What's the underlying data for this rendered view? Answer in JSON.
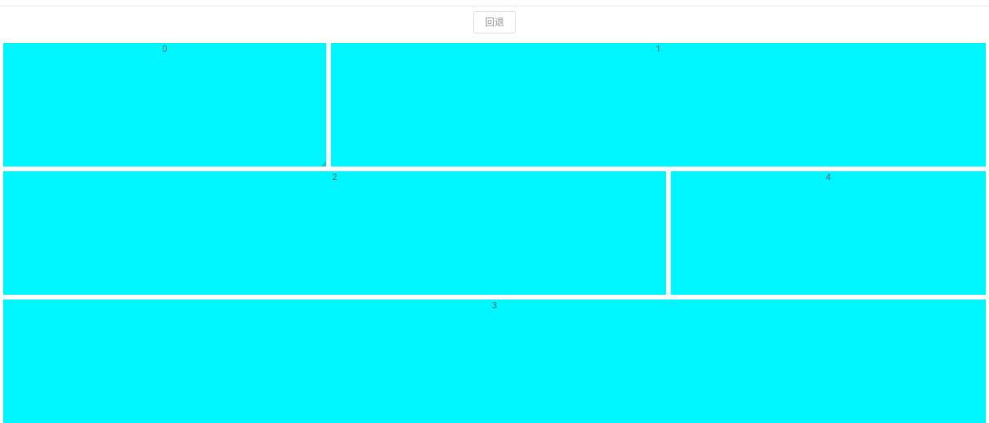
{
  "toolbar": {
    "back_label": "回退"
  },
  "panels": {
    "item0": {
      "label": "0"
    },
    "item1": {
      "label": "1"
    },
    "item2": {
      "label": "2"
    },
    "item3": {
      "label": "3"
    },
    "item4": {
      "label": "4"
    }
  },
  "colors": {
    "panel_bg": "#00f6ff"
  }
}
